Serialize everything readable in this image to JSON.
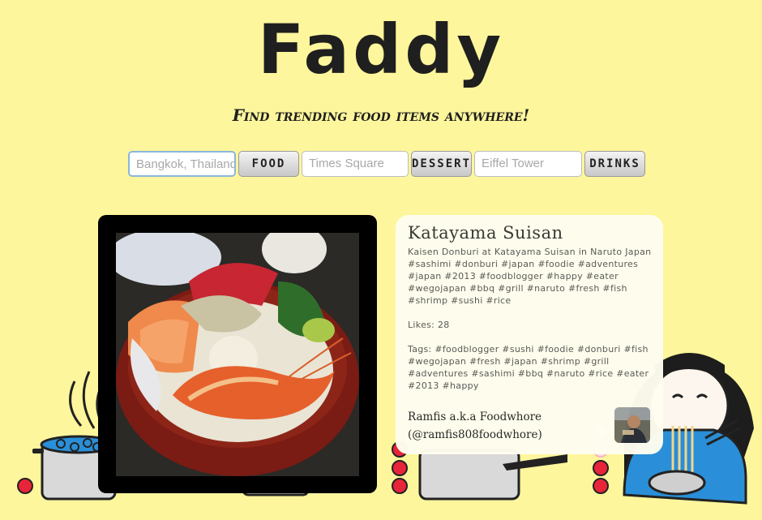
{
  "header": {
    "title": "Faddy",
    "tagline": "Find trending food items anywhere!"
  },
  "search": {
    "food": {
      "placeholder": "Bangkok, Thailand",
      "button": "FOOD"
    },
    "dessert": {
      "placeholder": "Times Square",
      "button": "DESSERT"
    },
    "drinks": {
      "placeholder": "Eiffel Tower",
      "button": "DRINKS"
    }
  },
  "result": {
    "restaurant": "Katayama Suisan",
    "caption": "Kaisen Donburi at Katayama Suisan in Naruto Japan #sashimi #donburi #japan #foodie #adventures #japan #2013 #foodblogger #happy #eater #wegojapan #bbq #grill #naruto #fresh #fish #shrimp #sushi #rice",
    "likes": "Likes: 28",
    "tags": "Tags: #foodblogger #sushi #foodie #donburi #fish #wegojapan #fresh #japan #shrimp #grill #adventures #sashimi #bbq #naruto #rice #eater #2013 #happy",
    "user_name": "Ramfis a.k.a Foodwhore",
    "user_handle": "(@ramfis808foodwhore)"
  },
  "colors": {
    "background": "#fef69c",
    "pot_blue": "#2a8fd8",
    "stove_dot": "#e8243a"
  },
  "icons": [
    "steaming-pot-icon",
    "saucepan-icon",
    "noodle-eater-icon",
    "stove-knob-icon"
  ]
}
